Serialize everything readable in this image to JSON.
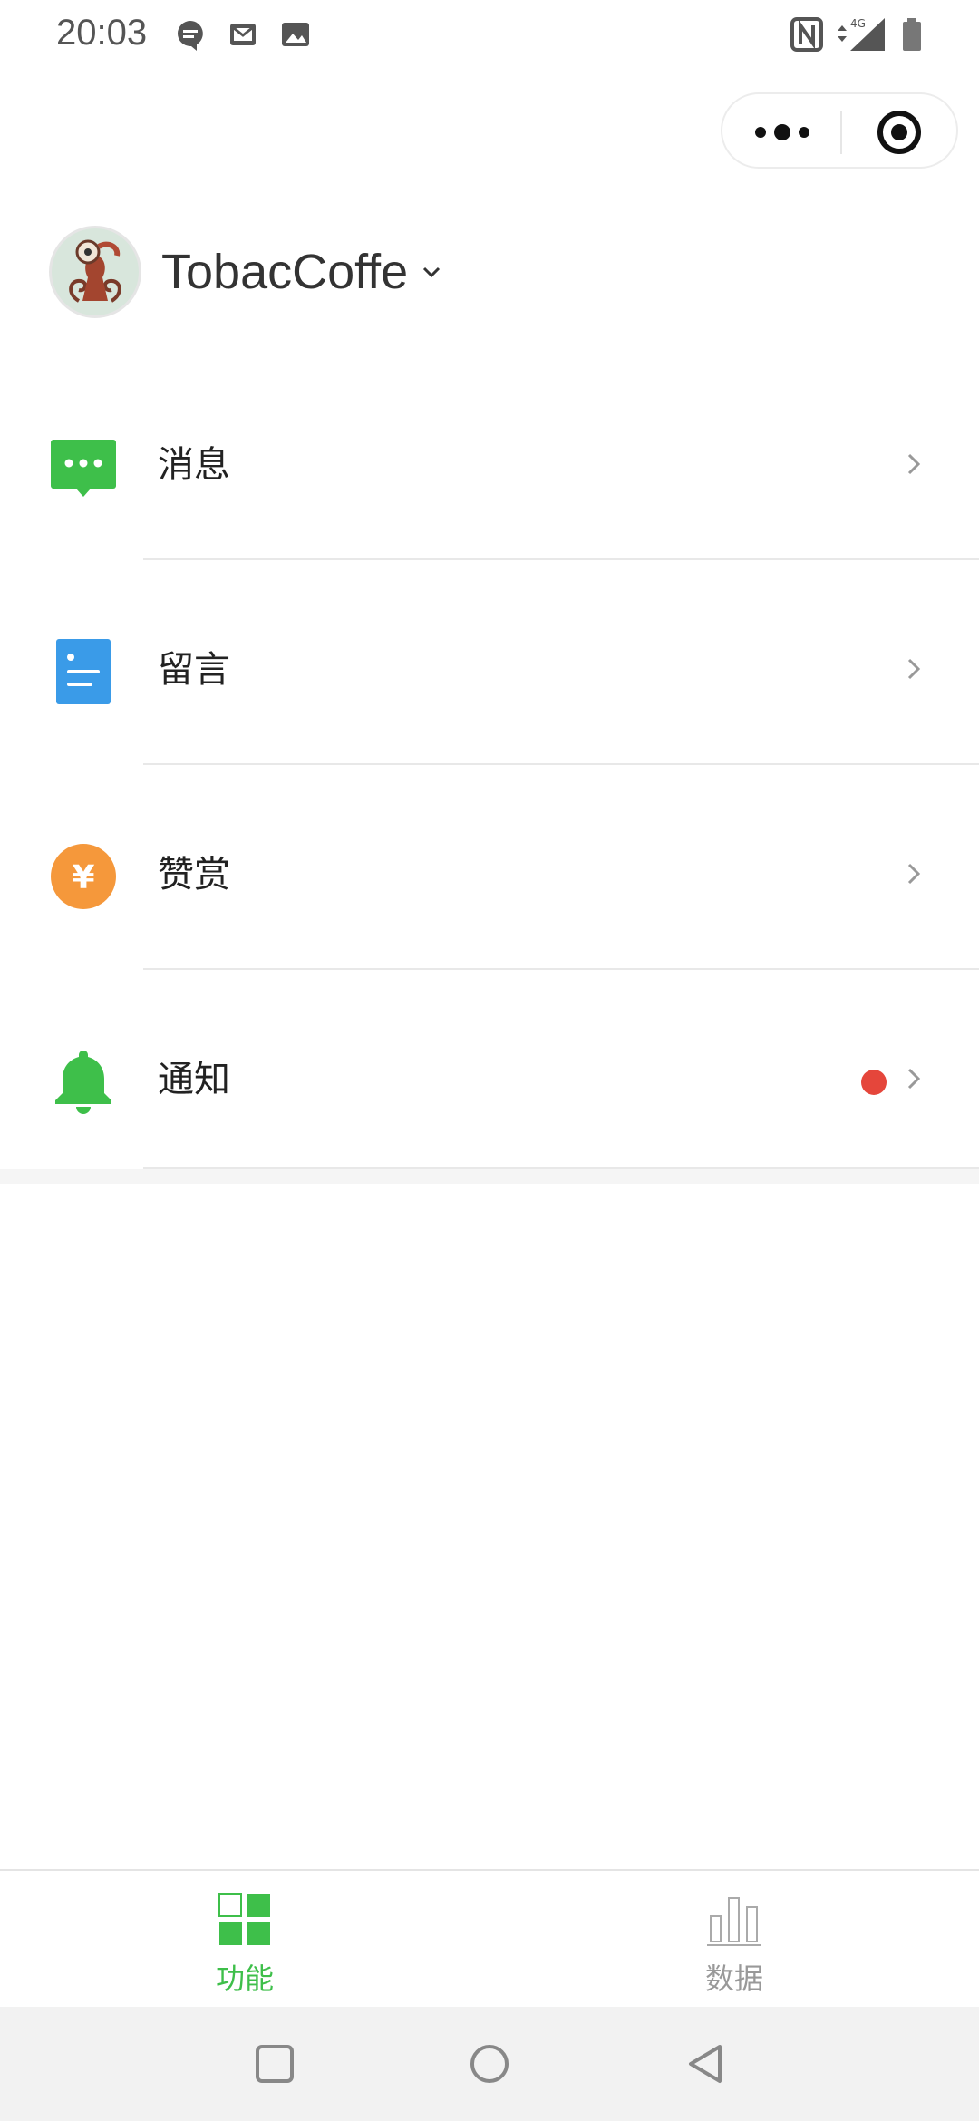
{
  "status_bar": {
    "time": "20:03",
    "left_icons": [
      "chat-notification-icon",
      "mail-icon",
      "image-icon"
    ],
    "right_icons": [
      "nfc-icon",
      "4g-signal-icon",
      "battery-icon"
    ],
    "network_label": "4G"
  },
  "capsule": {
    "more_icon": "more-dots-icon",
    "close_icon": "target-close-icon"
  },
  "account": {
    "name": "TobacCoffe",
    "dropdown_icon": "chevron-down-icon"
  },
  "menu": {
    "items": [
      {
        "label": "消息",
        "icon": "message-icon",
        "color": "#3ebf4a",
        "badge": false
      },
      {
        "label": "留言",
        "icon": "comment-doc-icon",
        "color": "#3a9be8",
        "badge": false
      },
      {
        "label": "赞赏",
        "icon": "yen-coin-icon",
        "color": "#f5983b",
        "badge": false
      },
      {
        "label": "通知",
        "icon": "bell-icon",
        "color": "#3ebf4a",
        "badge": true,
        "badge_color": "#e5463b"
      }
    ]
  },
  "tabbar": {
    "tabs": [
      {
        "label": "功能",
        "icon": "grid-icon",
        "active": true,
        "color": "#3ebf4a"
      },
      {
        "label": "数据",
        "icon": "bar-chart-icon",
        "active": false,
        "color": "#999999"
      }
    ]
  },
  "navbar": {
    "buttons": [
      "recent-apps-icon",
      "home-icon",
      "back-icon"
    ]
  }
}
